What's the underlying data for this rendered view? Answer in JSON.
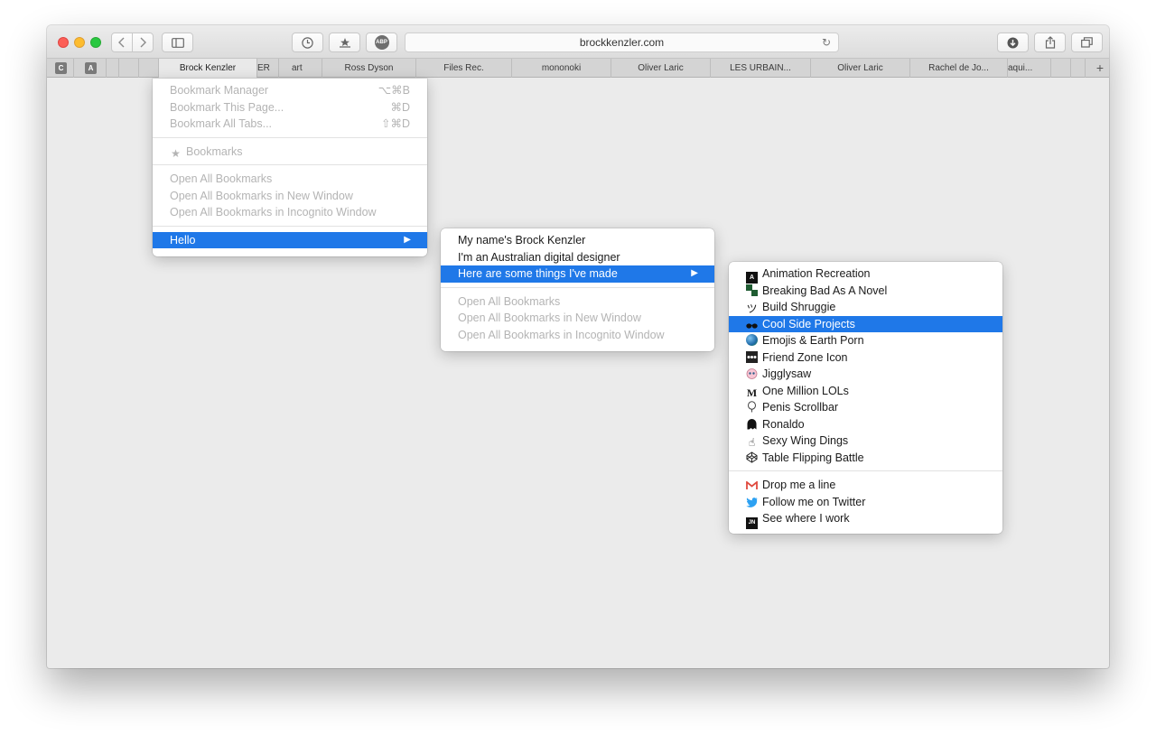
{
  "browser": {
    "url": "brockkenzler.com",
    "abp_label": "ABP",
    "bookmarks_bar": {
      "square_labels": [
        "C",
        "A"
      ],
      "items": [
        "Brock Kenzler",
        "ER",
        "art",
        "Ross Dyson",
        "Files Rec.",
        "mononoki",
        "Oliver Laric",
        "LES URBAIN...",
        "Oliver Laric",
        "Rachel de Jo...",
        "aqui..."
      ],
      "add_label": "+"
    }
  },
  "menu1": {
    "items": [
      {
        "label": "Bookmark Manager",
        "shortcut": "⌥⌘B"
      },
      {
        "label": "Bookmark This Page...",
        "shortcut": "⌘D"
      },
      {
        "label": "Bookmark All Tabs...",
        "shortcut": "⇧⌘D"
      }
    ],
    "bookmarks_label": "Bookmarks",
    "open_items": [
      "Open All Bookmarks",
      "Open All Bookmarks in New Window",
      "Open All Bookmarks in Incognito Window"
    ],
    "hello_label": "Hello"
  },
  "menu2": {
    "items": [
      "My name's Brock Kenzler",
      "I'm an Australian digital designer",
      "Here are some things I've made"
    ],
    "open_items": [
      "Open All Bookmarks",
      "Open All Bookmarks in New Window",
      "Open All Bookmarks in Incognito Window"
    ]
  },
  "menu3": {
    "projects": [
      {
        "label": "Animation Recreation",
        "icon": "a-square-icon"
      },
      {
        "label": "Breaking Bad As A Novel",
        "icon": "breaking-bad-icon"
      },
      {
        "label": "Build Shruggie",
        "icon": "shruggie-icon"
      },
      {
        "label": "Cool Side Projects",
        "icon": "sunglasses-icon"
      },
      {
        "label": "Emojis & Earth Porn",
        "icon": "globe-icon"
      },
      {
        "label": "Friend Zone Icon",
        "icon": "friend-zone-icon"
      },
      {
        "label": "Jigglysaw",
        "icon": "jigglypuff-icon"
      },
      {
        "label": "One Million LOLs",
        "icon": "m-letter-icon"
      },
      {
        "label": "Penis Scrollbar",
        "icon": "balloon-icon"
      },
      {
        "label": "Ronaldo",
        "icon": "ghost-icon"
      },
      {
        "label": "Sexy Wing Dings",
        "icon": "hand-icon"
      },
      {
        "label": "Table Flipping Battle",
        "icon": "codepen-icon"
      }
    ],
    "contact": [
      {
        "label": "Drop me a line",
        "icon": "gmail-icon"
      },
      {
        "label": "Follow me on Twitter",
        "icon": "twitter-icon"
      },
      {
        "label": "See where I work",
        "icon": "jn-logo-icon"
      }
    ],
    "icon_glyphs": {
      "a_square": "A",
      "m_letter": "M",
      "jn_logo": "JN"
    }
  },
  "colors": {
    "highlight": "#1f78e8",
    "close": "#fc5f57",
    "minimize": "#fdbc2e",
    "zoom": "#28c840"
  }
}
